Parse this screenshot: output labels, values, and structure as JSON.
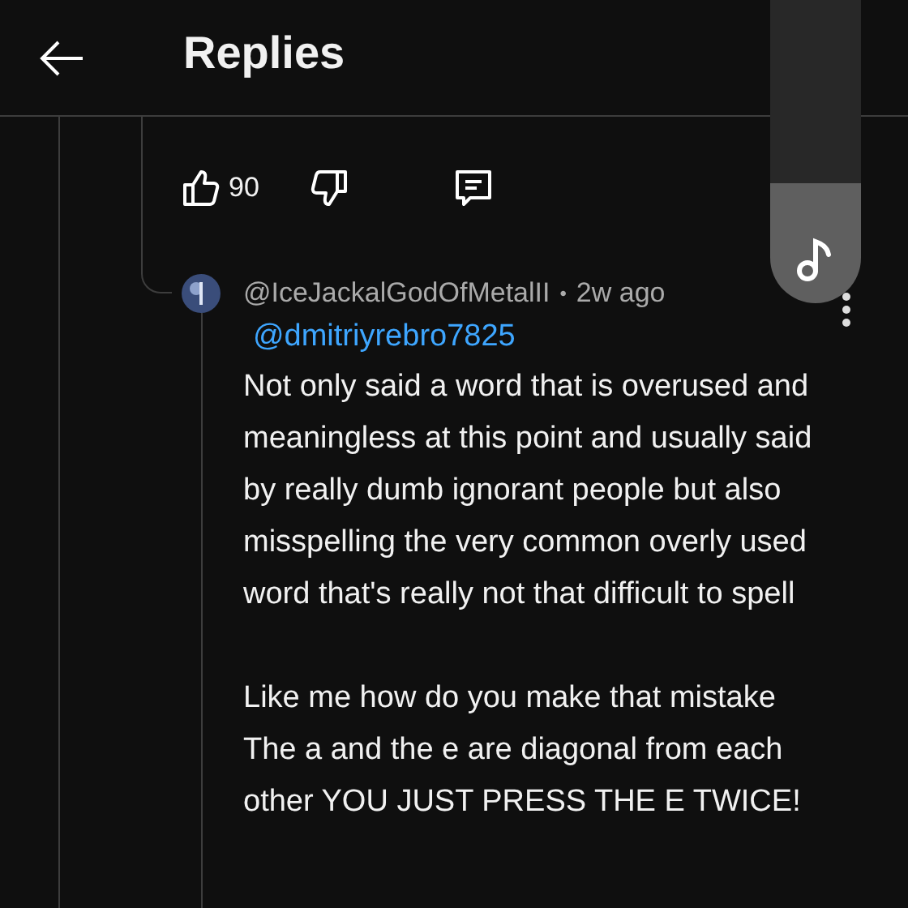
{
  "header": {
    "title": "Replies"
  },
  "parent_actions": {
    "likes": "90"
  },
  "reply": {
    "author": "@IceJackalGodOfMetalII",
    "separator": "•",
    "time": "2w ago",
    "mention": "@dmitriyrebro7825",
    "paragraphs": [
      "Not only said a word that is overused and meaningless at this point and usually said by really dumb ignorant people but also misspelling the very common overly used word that's really not that difficult to spell",
      "Like me how do you make that mistake The a and the e are diagonal from each other YOU JUST PRESS THE E TWICE!"
    ]
  }
}
